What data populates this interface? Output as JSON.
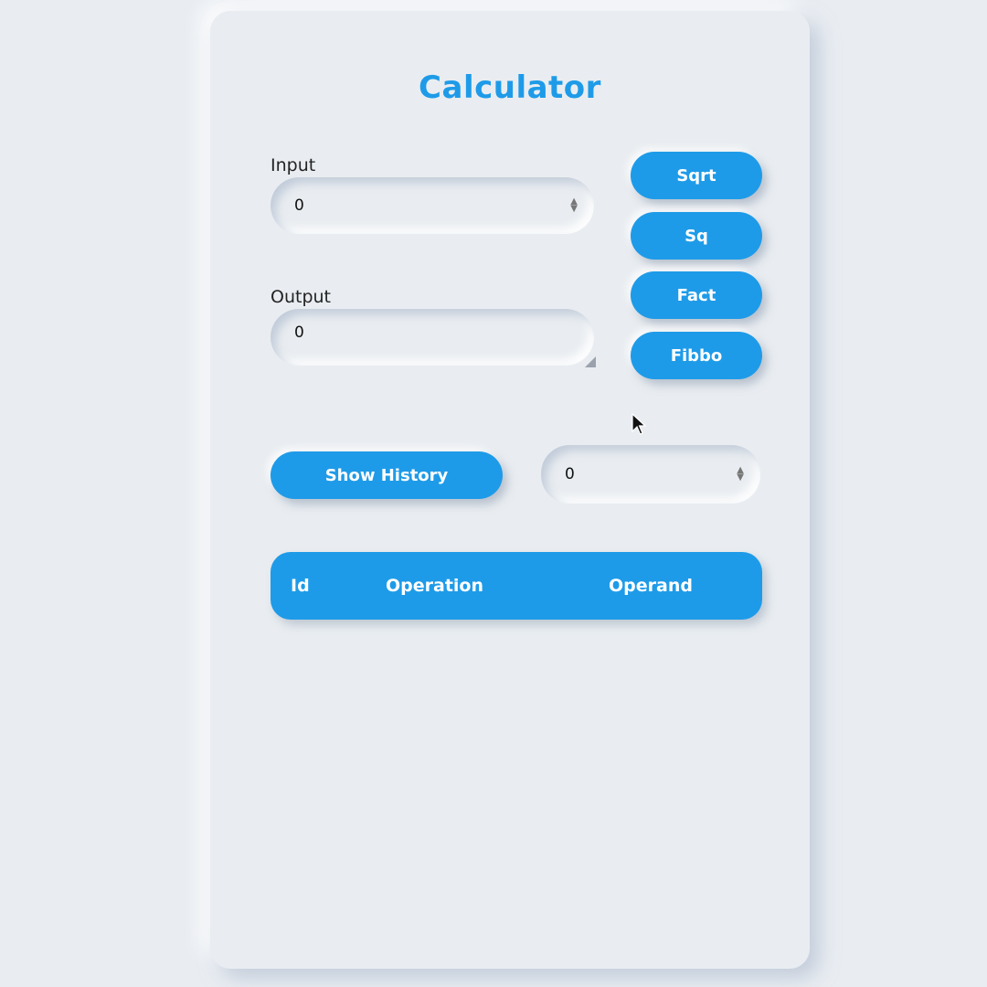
{
  "app": {
    "title": "Calculator"
  },
  "input": {
    "label": "Input",
    "value": "0"
  },
  "output": {
    "label": "Output",
    "value": "0"
  },
  "operations": {
    "sqrt_label": "Sqrt",
    "sq_label": "Sq",
    "fact_label": "Fact",
    "fibbo_label": "Fibbo"
  },
  "history": {
    "button_label": "Show History",
    "count_value": "0"
  },
  "table": {
    "headers": [
      "Id",
      "Operation",
      "Operand"
    ]
  },
  "colors": {
    "accent": "#1e9be8",
    "background": "#e9edf1"
  },
  "icons": {
    "spinner": "spinner-arrows-icon",
    "resize": "resize-handle-icon",
    "cursor": "mouse-pointer-icon"
  }
}
